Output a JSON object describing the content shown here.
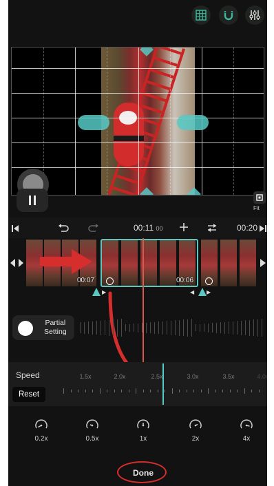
{
  "toolbar": {
    "icons": [
      "grid-icon",
      "magnet-icon",
      "adjust-sliders-icon"
    ],
    "accent": "#3fb59b"
  },
  "preview": {
    "fit_label": "Fit"
  },
  "timeline": {
    "current_time": "00:11",
    "current_frames": "00",
    "total_time": "00:20",
    "clip_start_label": "00:07",
    "clip_duration_label": "00:06",
    "selection_color": "#5cc7c1",
    "playhead_color": "#d95a4b"
  },
  "partial": {
    "label_line1": "Partial",
    "label_line2": "Setting"
  },
  "speed": {
    "title": "Speed",
    "reset_label": "Reset",
    "scale_labels": [
      "1.5x",
      "2.0x",
      "2.5x",
      "3.0x",
      "3.5x",
      "4.0x"
    ],
    "current_value": 2.5
  },
  "presets": [
    {
      "label": "0.2x",
      "icon": "speedometer-slow-icon"
    },
    {
      "label": "0.5x",
      "icon": "speedometer-low-icon"
    },
    {
      "label": "1x",
      "icon": "speedometer-normal-icon"
    },
    {
      "label": "2x",
      "icon": "speedometer-fast-icon"
    },
    {
      "label": "4x",
      "icon": "speedometer-max-icon"
    }
  ],
  "done_label": "Done",
  "annotation_color": "#d62d2d"
}
